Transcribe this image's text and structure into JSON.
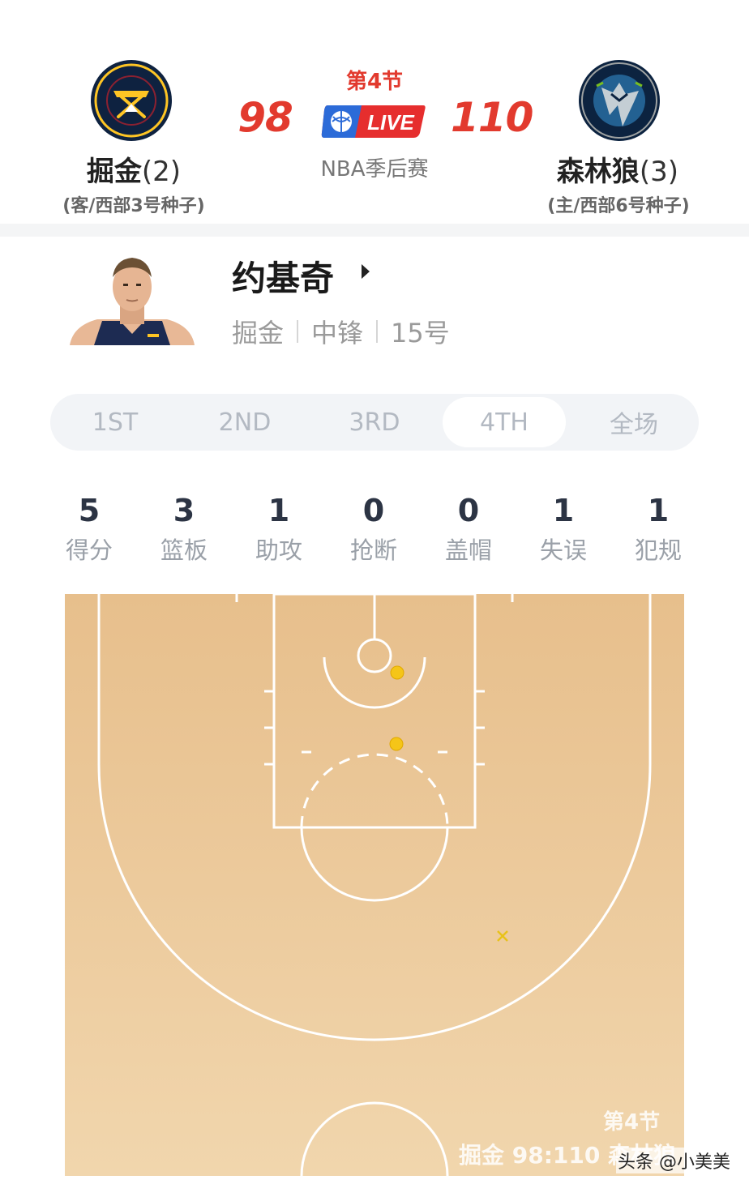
{
  "header": {
    "period": "第4节",
    "league": "NBA季后赛",
    "live_label": "LIVE",
    "away": {
      "name": "掘金",
      "series": "(2)",
      "seed": "(客/西部3号种子)",
      "score": "98",
      "logo_icon": "nuggets-logo",
      "colors": {
        "primary": "#0e2240",
        "accent": "#fec524"
      }
    },
    "home": {
      "name": "森林狼",
      "series": "(3)",
      "seed": "(主/西部6号种子)",
      "score": "110",
      "logo_icon": "timberwolves-logo",
      "colors": {
        "primary": "#0c2340",
        "accent": "#78be20"
      }
    },
    "score_color": "#e23a2e"
  },
  "player": {
    "name": "约基奇",
    "arrow_icon": "caret-right-icon",
    "team": "掘金",
    "position": "中锋",
    "number": "15号"
  },
  "tabs": [
    {
      "label": "1ST",
      "active": false
    },
    {
      "label": "2ND",
      "active": false
    },
    {
      "label": "3RD",
      "active": false
    },
    {
      "label": "4TH",
      "active": true
    },
    {
      "label": "全场",
      "active": false
    }
  ],
  "stats": [
    {
      "value": "5",
      "label": "得分"
    },
    {
      "value": "3",
      "label": "篮板"
    },
    {
      "value": "1",
      "label": "助攻"
    },
    {
      "value": "0",
      "label": "抢断"
    },
    {
      "value": "0",
      "label": "盖帽"
    },
    {
      "value": "1",
      "label": "失误"
    },
    {
      "value": "1",
      "label": "犯规"
    }
  ],
  "shot_chart": {
    "made_color": "#f5c518",
    "missed_color": "#e8c21a",
    "shots": [
      {
        "result": "made"
      },
      {
        "result": "made"
      },
      {
        "result": "missed"
      }
    ]
  },
  "watermark": {
    "period": "第4节",
    "score_line": "掘金 98:110 森林狼",
    "source": "头条 @小美美"
  }
}
